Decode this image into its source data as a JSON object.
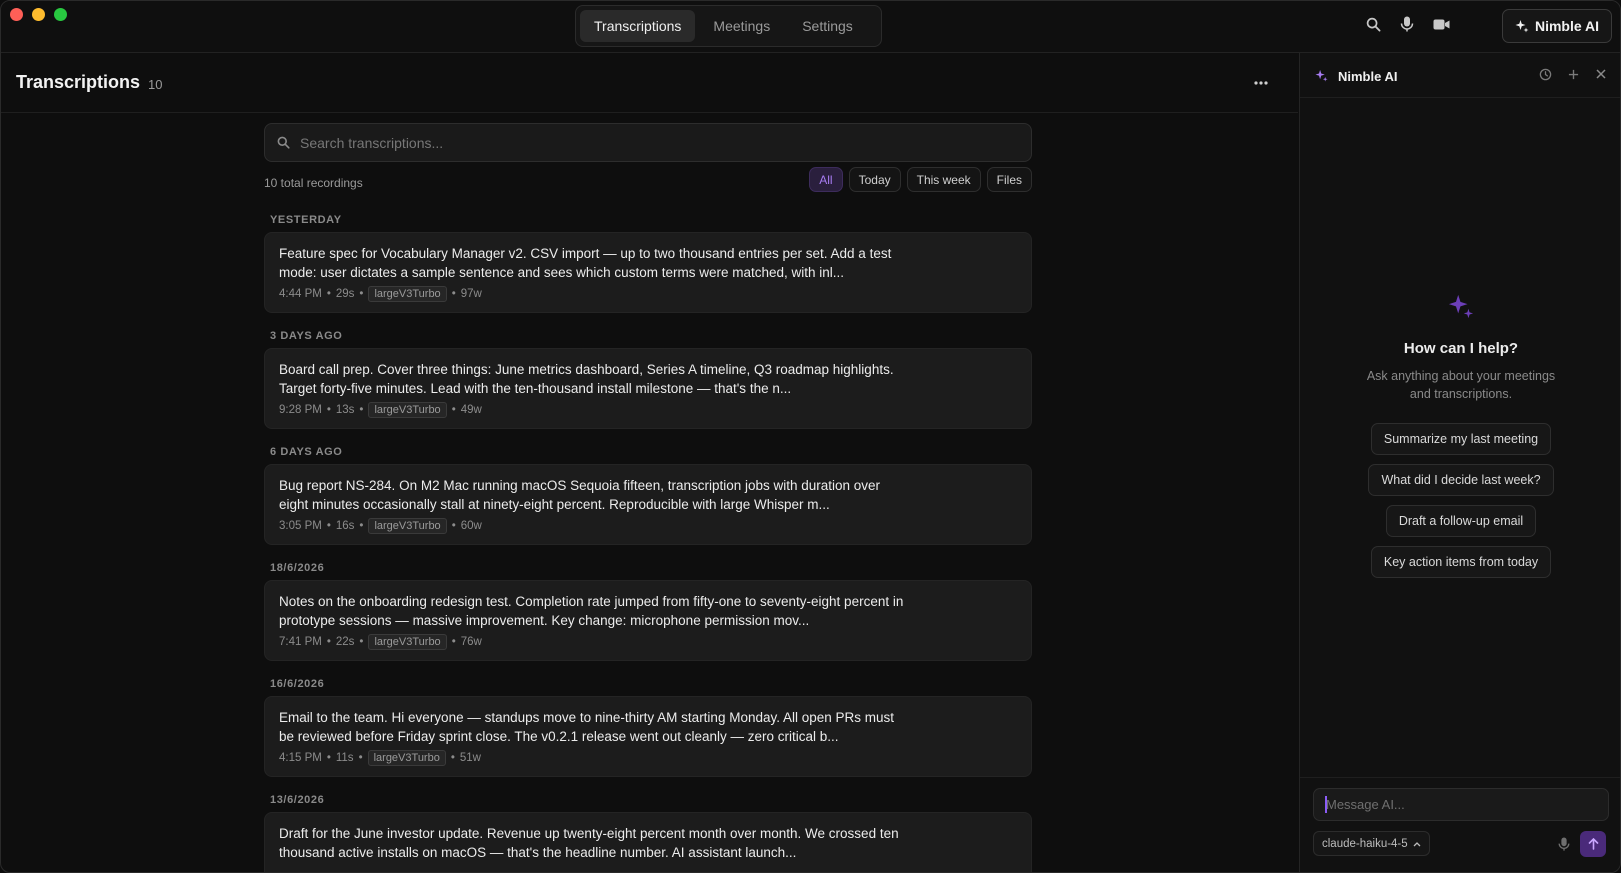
{
  "titlebar": {
    "tabs": [
      {
        "label": "Transcriptions",
        "active": true
      },
      {
        "label": "Meetings",
        "active": false
      },
      {
        "label": "Settings",
        "active": false
      }
    ],
    "icons": [
      "search-icon",
      "microphone-icon",
      "video-camera-icon"
    ],
    "nimble_button": "Nimble AI"
  },
  "main": {
    "title": "Transcriptions",
    "count": "10",
    "search_placeholder": "Search transcriptions...",
    "totals": "10 total recordings",
    "filters": [
      {
        "label": "All",
        "active": true
      },
      {
        "label": "Today",
        "active": false
      },
      {
        "label": "This week",
        "active": false
      },
      {
        "label": "Files",
        "active": false
      }
    ],
    "groups": [
      {
        "label": "YESTERDAY",
        "items": [
          {
            "text": "Feature spec for Vocabulary Manager v2. CSV import — up to two thousand entries per set. Add a test mode: user dictates a sample sentence and sees which custom terms were matched, with inl...",
            "time": "4:44 PM",
            "duration": "29s",
            "model": "largeV3Turbo",
            "words": "97w"
          }
        ]
      },
      {
        "label": "3 DAYS AGO",
        "items": [
          {
            "text": "Board call prep. Cover three things: June metrics dashboard, Series A timeline, Q3 roadmap highlights. Target forty-five minutes. Lead with the ten-thousand install milestone — that's the n...",
            "time": "9:28 PM",
            "duration": "13s",
            "model": "largeV3Turbo",
            "words": "49w"
          }
        ]
      },
      {
        "label": "6 DAYS AGO",
        "items": [
          {
            "text": "Bug report NS-284. On M2 Mac running macOS Sequoia fifteen, transcription jobs with duration over eight minutes occasionally stall at ninety-eight percent. Reproducible with large Whisper m...",
            "time": "3:05 PM",
            "duration": "16s",
            "model": "largeV3Turbo",
            "words": "60w"
          }
        ]
      },
      {
        "label": "18/6/2026",
        "items": [
          {
            "text": "Notes on the onboarding redesign test. Completion rate jumped from fifty-one to seventy-eight percent in prototype sessions — massive improvement. Key change: microphone permission mov...",
            "time": "7:41 PM",
            "duration": "22s",
            "model": "largeV3Turbo",
            "words": "76w"
          }
        ]
      },
      {
        "label": "16/6/2026",
        "items": [
          {
            "text": "Email to the team. Hi everyone — standups move to nine-thirty AM starting Monday. All open PRs must be reviewed before Friday sprint close. The v0.2.1 release went out cleanly — zero critical b...",
            "time": "4:15 PM",
            "duration": "11s",
            "model": "largeV3Turbo",
            "words": "51w"
          }
        ]
      },
      {
        "label": "13/6/2026",
        "items": [
          {
            "text": "Draft for the June investor update. Revenue up twenty-eight percent month over month. We crossed ten thousand active installs on macOS — that's the headline number. AI assistant launch...",
            "time": "",
            "duration": "",
            "model": "",
            "words": ""
          }
        ]
      }
    ]
  },
  "panel": {
    "title": "Nimble AI",
    "empty_title": "How can I help?",
    "empty_subtitle": "Ask anything about your meetings and transcriptions.",
    "suggestions": [
      "Summarize my last meeting",
      "What did I decide last week?",
      "Draft a follow-up email",
      "Key action items from today"
    ],
    "input_placeholder": "Message AI...",
    "model": "claude-haiku-4-5"
  },
  "colors": {
    "accent": "#8b5cf6",
    "accent_text": "#a77cf2",
    "background": "#0e0e0e",
    "card": "#1c1c1c"
  }
}
